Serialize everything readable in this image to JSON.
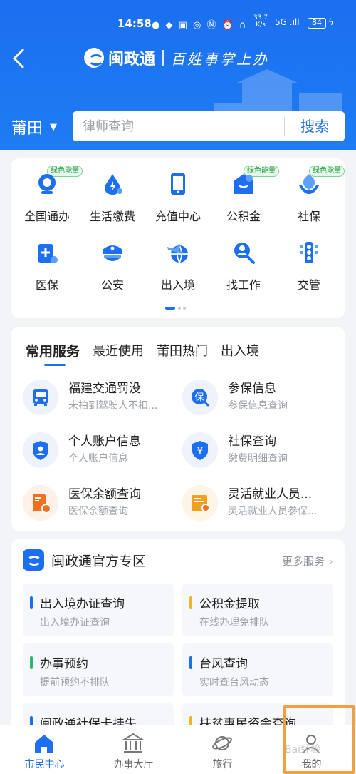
{
  "status_bar": {
    "time": "14:58",
    "net_speed_top": "33.7",
    "net_speed_unit": "K/s",
    "signal": "5G .ıll",
    "battery": "84"
  },
  "header": {
    "app_name": "闽政通",
    "slogan": "百姓事掌上办"
  },
  "search": {
    "city": "莆田",
    "placeholder": "律师查询",
    "button": "搜索"
  },
  "grid": {
    "badge_text": "绿色能量",
    "items": [
      {
        "label": "全国通办",
        "icon": "globe-service-icon",
        "badge": true
      },
      {
        "label": "生活缴费",
        "icon": "water-drop-icon",
        "badge": false
      },
      {
        "label": "充值中心",
        "icon": "phone-icon",
        "badge": false
      },
      {
        "label": "公积金",
        "icon": "fund-icon",
        "badge": true
      },
      {
        "label": "社保",
        "icon": "shield-hand-icon",
        "badge": true
      },
      {
        "label": "医保",
        "icon": "medical-insurance-icon",
        "badge": false
      },
      {
        "label": "公安",
        "icon": "police-cap-icon",
        "badge": false
      },
      {
        "label": "出入境",
        "icon": "plane-globe-icon",
        "badge": false
      },
      {
        "label": "找工作",
        "icon": "job-search-icon",
        "badge": false
      },
      {
        "label": "交管",
        "icon": "traffic-light-icon",
        "badge": false
      }
    ]
  },
  "services": {
    "tabs": [
      "常用服务",
      "最近使用",
      "莆田热门",
      "出入境"
    ],
    "items": [
      {
        "title": "福建交通罚没",
        "sub": "未拍到驾驶人不扣...",
        "icon": "bus-icon"
      },
      {
        "title": "参保信息",
        "sub": "参保信息查询",
        "icon": "insurance-badge-icon"
      },
      {
        "title": "个人账户信息",
        "sub": "个人账户信息",
        "icon": "account-shield-icon"
      },
      {
        "title": "社保查询",
        "sub": "缴费明细查询",
        "icon": "yen-shield-icon"
      },
      {
        "title": "医保余额查询",
        "sub": "医保余额查询",
        "icon": "medical-card-icon"
      },
      {
        "title": "灵活就业人员...",
        "sub": "灵活就业人员参保...",
        "icon": "employment-card-icon"
      }
    ]
  },
  "official": {
    "title": "闽政通官方专区",
    "more": "更多服务",
    "tiles": [
      {
        "title": "出入境办证查询",
        "sub": "出入境办证查询",
        "color": "#1b6ff0"
      },
      {
        "title": "公积金提取",
        "sub": "在线办理免排队",
        "color": "#f0b429"
      },
      {
        "title": "办事预约",
        "sub": "提前预约不排队",
        "color": "#2bb673"
      },
      {
        "title": "台风查询",
        "sub": "实时查台风动态",
        "color": "#1b6ff0"
      },
      {
        "title": "闽政通社保卡挂失",
        "sub": "",
        "color": "#1b6ff0"
      },
      {
        "title": "扶贫惠民资金查询",
        "sub": "",
        "color": "#f0b429"
      }
    ]
  },
  "bottom_nav": [
    "市民中心",
    "办事大厅",
    "旅行",
    "我的"
  ],
  "watermark": "Bai经验",
  "colors": {
    "primary": "#1b6ff0",
    "badge_green": "#1a9a3a",
    "highlight": "#f0a040"
  }
}
